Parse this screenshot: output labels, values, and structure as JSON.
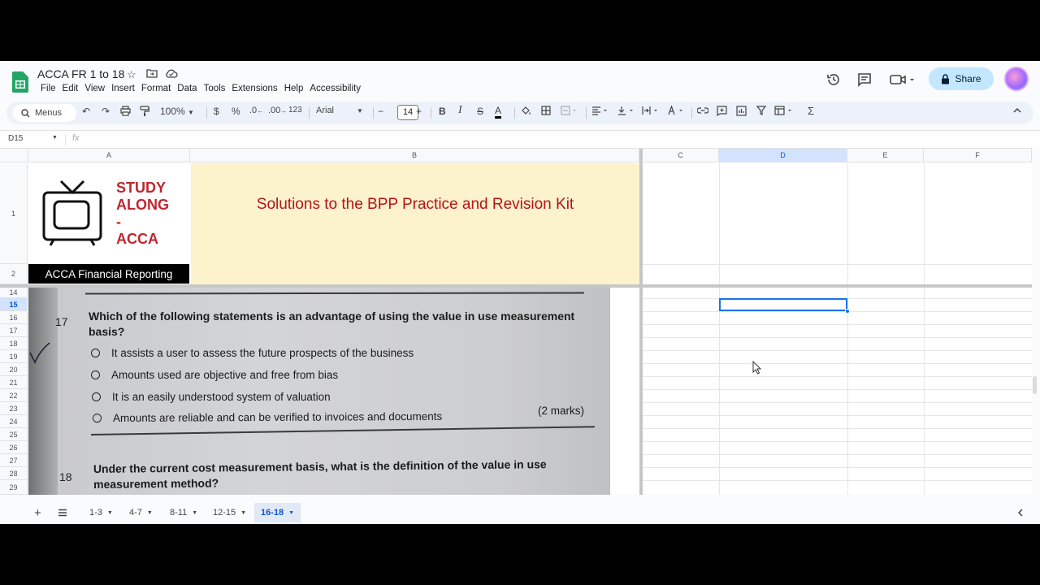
{
  "app": {
    "doc_title": "ACCA FR 1 to 18",
    "menu": [
      "File",
      "Edit",
      "View",
      "Insert",
      "Format",
      "Data",
      "Tools",
      "Extensions",
      "Help",
      "Accessibility"
    ],
    "share_label": "Share"
  },
  "toolbar": {
    "menus_label": "Menus",
    "zoom": "100%",
    "currency": "$",
    "percent": "%",
    "dec_decrease": ".0",
    "dec_increase": ".00",
    "number_format": "123",
    "font": "Arial",
    "font_size": "14",
    "minus": "−",
    "plus": "+"
  },
  "formula": {
    "name_box": "D15",
    "fx": "fx",
    "value": ""
  },
  "columns": [
    "A",
    "B",
    "C",
    "D",
    "E",
    "F"
  ],
  "rows_top": [
    "1",
    "2"
  ],
  "rows_bottom": [
    "14",
    "15",
    "16",
    "17",
    "18",
    "19",
    "20",
    "21",
    "22",
    "23",
    "24",
    "25",
    "26",
    "27",
    "28",
    "29"
  ],
  "selected": {
    "cell": "D15",
    "column": "D",
    "row": "15"
  },
  "header": {
    "brand": [
      "STUDY",
      "ALONG",
      "-",
      "ACCA"
    ],
    "banner_text": "Solutions to the BPP Practice and Revision Kit",
    "ribbon_text": "ACCA Financial Reporting"
  },
  "photo": {
    "q17_num": "17",
    "q17_text": "Which of the following statements is an advantage of using the value in use measurement basis?",
    "options": [
      "It assists a user to assess the future prospects of the business",
      "Amounts used are objective and free from bias",
      "It is an easily understood system of valuation",
      "Amounts are reliable and can be verified to invoices and documents"
    ],
    "marks": "(2 marks)",
    "q18_num": "18",
    "q18_text": "Under the current cost measurement basis, what is the definition of the value in use measurement method?"
  },
  "sheets": {
    "tabs": [
      "1-3",
      "4-7",
      "8-11",
      "12-15",
      "16-18"
    ],
    "active": "16-18"
  }
}
